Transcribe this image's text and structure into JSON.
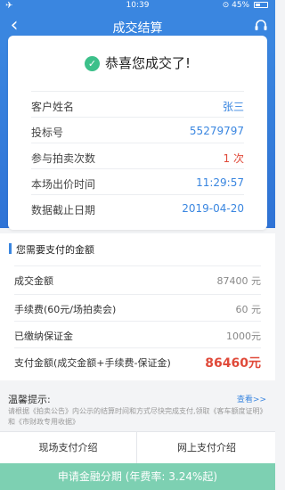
{
  "status_bar": {
    "time": "10:39",
    "battery": "45%",
    "battery_level": 0.45,
    "icons": [
      "airplane-icon",
      "location-icon",
      "battery-icon"
    ]
  },
  "nav": {
    "title": "成交结算",
    "back_icon": "chevron-left-icon",
    "service_icon": "headset-icon"
  },
  "summary": {
    "congrats": "恭喜您成交了!",
    "rows": [
      {
        "label": "客户姓名",
        "value": "张三"
      },
      {
        "label": "投标号",
        "value": "55279797"
      },
      {
        "label": "参与拍卖次数",
        "value": "1 次"
      },
      {
        "label": "本场出价时间",
        "value": "11:29:57"
      },
      {
        "label": "数据截止日期",
        "value": "2019-04-20"
      }
    ]
  },
  "payment": {
    "heading": "您需要支付的金额",
    "rows": [
      {
        "label": "成交金额",
        "value": "87400 元"
      },
      {
        "label": "手续费(60元/场拍卖会)",
        "value": "60 元"
      },
      {
        "label": "已缴纳保证金",
        "value": "1000元"
      },
      {
        "label": "支付金额(成交金额+手续费-保证金)",
        "value": "86460元"
      }
    ]
  },
  "tips": {
    "title": "温馨提示:",
    "link": "查看>>",
    "text": "请根据《拍卖公告》内公示的结算时间和方式尽快完成支付,领取《客车额度证明》和《市财政专用收据》"
  },
  "buttons": {
    "onsite": "现场支付介绍",
    "online": "网上支付介绍",
    "finance": "申请金融分期 (年费率: 3.24%起)"
  },
  "colors": {
    "primary": "#3a86e0",
    "accent_red": "#e04a3a",
    "success": "#3cc08a",
    "finance_bg": "#7dd0b2"
  }
}
